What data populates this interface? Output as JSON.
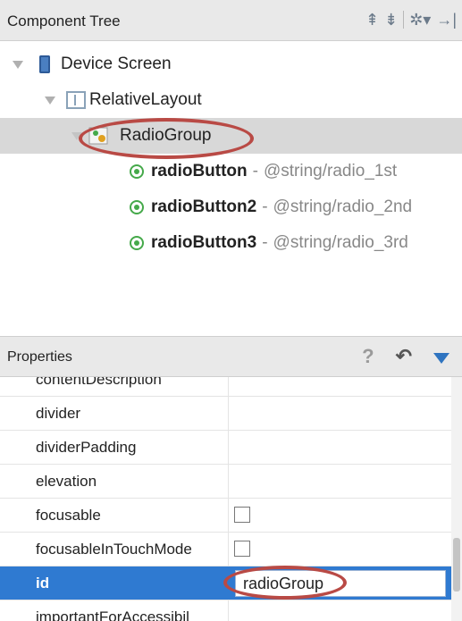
{
  "component_tree": {
    "title": "Component Tree",
    "header_icons": [
      "expand-all-icon",
      "collapse-all-icon",
      "settings-icon",
      "hide-panel-icon"
    ],
    "nodes": [
      {
        "label": "Device Screen",
        "icon": "phone-icon"
      },
      {
        "label": "RelativeLayout",
        "icon": "relative-layout-icon"
      },
      {
        "label": "RadioGroup",
        "icon": "radio-group-icon",
        "selected": true
      },
      {
        "label": "radioButton",
        "ref": "@string/radio_1st",
        "icon": "radio-button-icon"
      },
      {
        "label": "radioButton2",
        "ref": "@string/radio_2nd",
        "icon": "radio-button-icon"
      },
      {
        "label": "radioButton3",
        "ref": "@string/radio_3rd",
        "icon": "radio-button-icon"
      }
    ],
    "separator": "-"
  },
  "properties": {
    "title": "Properties",
    "header_icons": [
      "help-icon",
      "undo-icon",
      "filter-icon"
    ],
    "help_glyph": "?",
    "rows": [
      {
        "name": "contentDescription",
        "value": ""
      },
      {
        "name": "divider",
        "value": ""
      },
      {
        "name": "dividerPadding",
        "value": ""
      },
      {
        "name": "elevation",
        "value": ""
      },
      {
        "name": "focusable",
        "value": "",
        "checkbox": true
      },
      {
        "name": "focusableInTouchMode",
        "value": "",
        "checkbox": true
      },
      {
        "name": "id",
        "value": "radioGroup",
        "selected": true
      },
      {
        "name": "importantForAccessibil",
        "value": ""
      }
    ]
  },
  "colors": {
    "highlight_oval": "#b94a45",
    "selection_blue": "#2f7ad1",
    "radio_green": "#45a94a"
  }
}
